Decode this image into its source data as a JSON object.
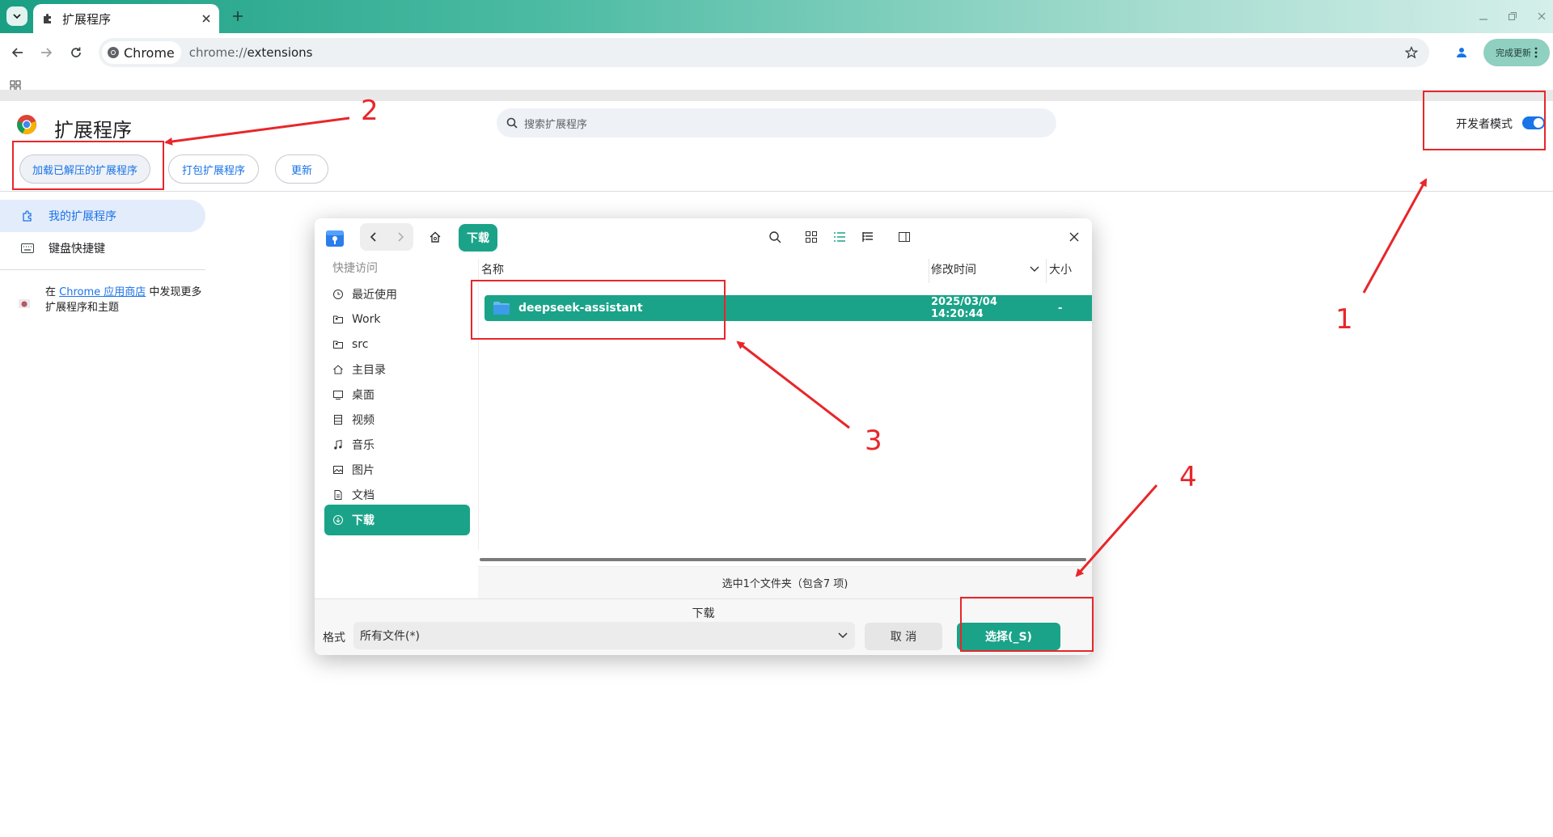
{
  "browser": {
    "tab_title": "扩展程序",
    "chip_label": "Chrome",
    "url_scheme": "chrome://",
    "url_path": "extensions",
    "update_label": "完成更新"
  },
  "extensions_page": {
    "title": "扩展程序",
    "search_placeholder": "搜索扩展程序",
    "dev_mode_label": "开发者模式",
    "dev_mode_on": true,
    "buttons": {
      "load_unpacked": "加载已解压的扩展程序",
      "pack": "打包扩展程序",
      "update": "更新"
    },
    "sidebar": {
      "my_extensions": "我的扩展程序",
      "keyboard_shortcuts": "键盘快捷键",
      "store_prefix": "在 ",
      "store_link": "Chrome 应用商店",
      "store_suffix": " 中发现更多扩展程序和主题"
    }
  },
  "file_dialog": {
    "current_folder": "下载",
    "sidebar_header": "快捷访问",
    "sidebar_items": [
      {
        "label": "最近使用",
        "icon": "clock-icon"
      },
      {
        "label": "Work",
        "icon": "folder-bookmark-icon"
      },
      {
        "label": "src",
        "icon": "folder-bookmark-icon"
      },
      {
        "label": "主目录",
        "icon": "home-icon"
      },
      {
        "label": "桌面",
        "icon": "desktop-icon"
      },
      {
        "label": "视频",
        "icon": "film-icon"
      },
      {
        "label": "音乐",
        "icon": "music-icon"
      },
      {
        "label": "图片",
        "icon": "image-icon"
      },
      {
        "label": "文档",
        "icon": "document-icon"
      },
      {
        "label": "下载",
        "icon": "download-icon"
      }
    ],
    "columns": {
      "name": "名称",
      "modified": "修改时间",
      "size": "大小"
    },
    "rows": [
      {
        "name": "deepseek-assistant",
        "modified": "2025/03/04 14:20:44",
        "size": "-"
      }
    ],
    "status": "选中1个文件夹（包含7 项)",
    "filename": "下载",
    "format_label": "格式",
    "format_value": "所有文件(*)",
    "cancel_label": "取 消",
    "select_label": "选择(_S)"
  },
  "annotations": [
    "1",
    "2",
    "3",
    "4"
  ],
  "colors": {
    "accent": "#1aa388",
    "chrome_blue": "#1a73e8",
    "annotation_red": "#e8262a"
  }
}
